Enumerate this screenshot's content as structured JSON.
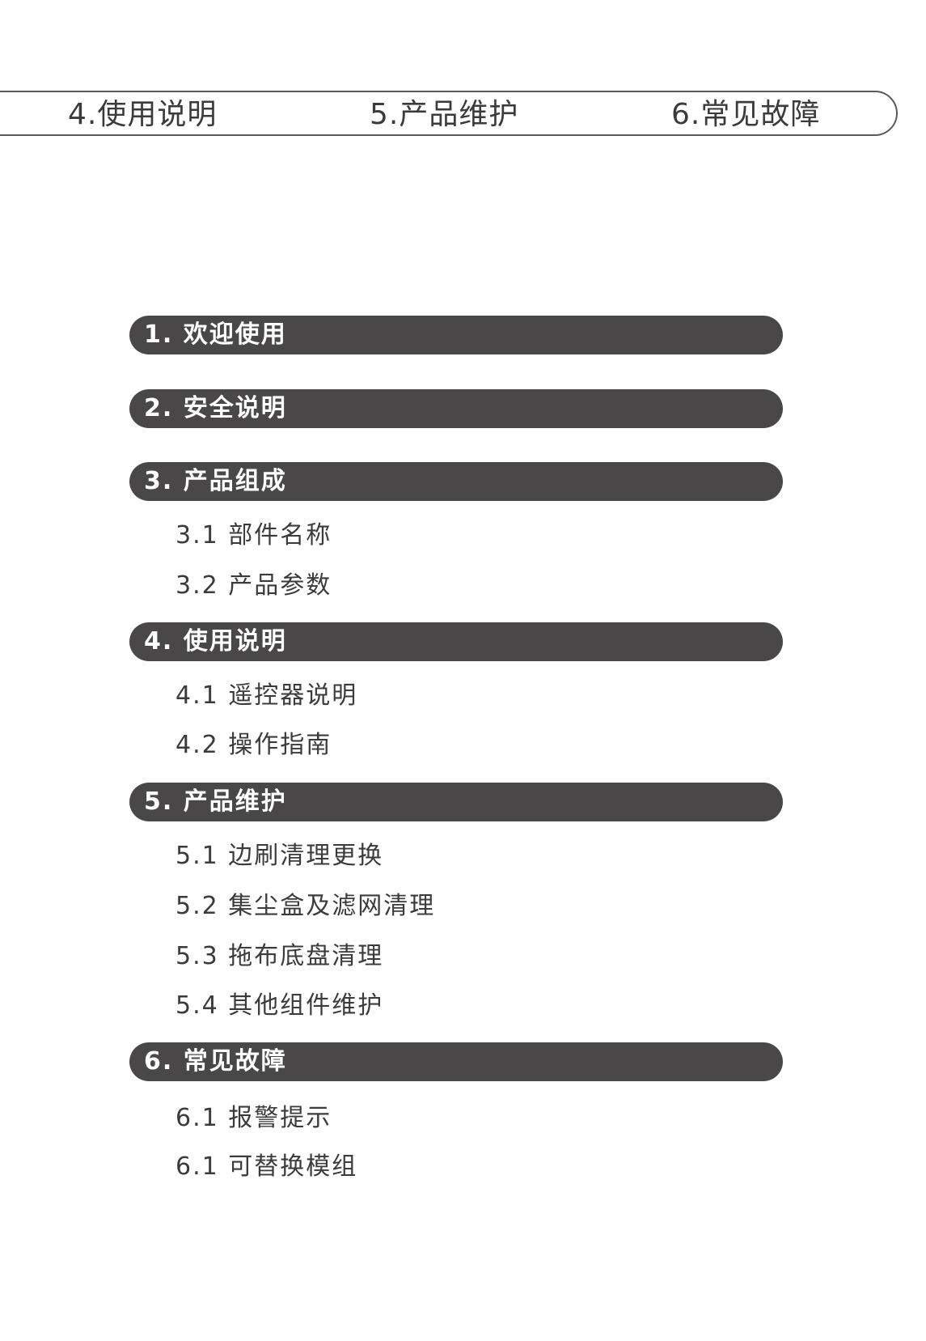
{
  "top_nav": {
    "items": [
      "4.使用说明",
      "5.产品维护",
      "6.常见故障"
    ]
  },
  "toc": {
    "sections": [
      {
        "label": "1. 欢迎使用",
        "subs": []
      },
      {
        "label": "2. 安全说明",
        "subs": []
      },
      {
        "label": "3. 产品组成",
        "subs": [
          "3.1  部件名称",
          "3.2  产品参数"
        ]
      },
      {
        "label": "4. 使用说明",
        "subs": [
          "4.1  遥控器说明",
          "4.2  操作指南"
        ]
      },
      {
        "label": "5. 产品维护",
        "subs": [
          "5.1  边刷清理更换",
          "5.2  集尘盒及滤网清理",
          "5.3  拖布底盘清理",
          "5.4  其他组件维护"
        ]
      },
      {
        "label": "6. 常见故障",
        "subs": [
          "6.1   报警提示",
          "6.1   可替换模组"
        ]
      }
    ]
  },
  "colors": {
    "section_bar": "#4a4748",
    "border": "#5a5a5a",
    "text": "#3b3b3b"
  }
}
